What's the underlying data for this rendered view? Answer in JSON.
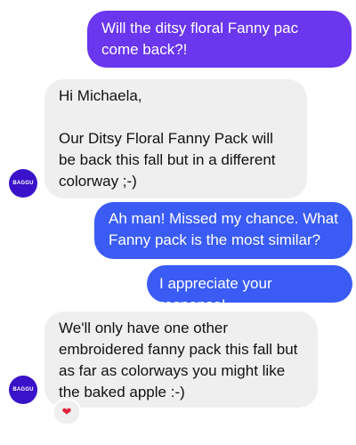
{
  "thread": {
    "messages": [
      {
        "from": "me",
        "text": "Will the ditsy floral Fanny pac come back?!"
      },
      {
        "from": "them",
        "text": "Hi Michaela,\n\nOur Ditsy Floral Fanny Pack will be back this fall but in a different colorway ;-)"
      },
      {
        "from": "me",
        "text": "Ah man! Missed my chance. What Fanny pack is the most similar?"
      },
      {
        "from": "me",
        "text": "I appreciate your response!"
      },
      {
        "from": "them",
        "text": "We'll only have one other embroidered fanny pack this fall but as far as colorways you might like the baked apple :-)"
      }
    ],
    "avatar_label": "BAGGU",
    "reaction_icon": "heart-icon",
    "colors": {
      "sent_gradient_top": "#7b2fe6",
      "sent_gradient_bottom": "#3a5cf4",
      "received_bg": "#efefef",
      "avatar_bg": "#3a12c9",
      "heart": "#e0243a"
    }
  }
}
